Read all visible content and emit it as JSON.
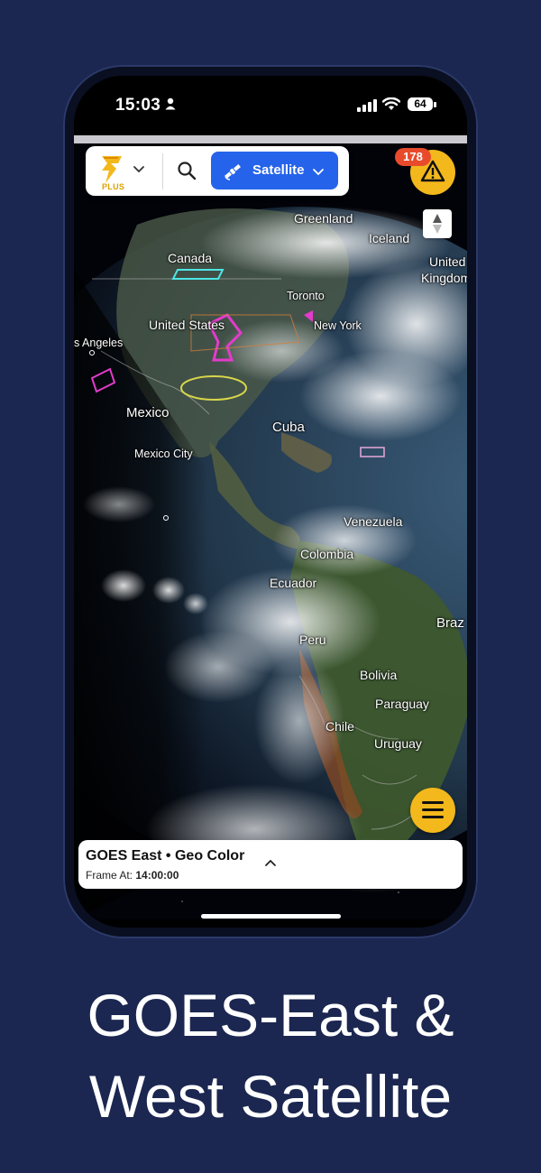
{
  "status_bar": {
    "time": "15:03",
    "battery": "64"
  },
  "toolbar": {
    "logo_badge": "PLUS",
    "layer_button_label": "Satellite"
  },
  "alerts": {
    "count": "178"
  },
  "map_labels": {
    "greenland": "Greenland",
    "iceland": "Iceland",
    "united_kingdom_1": "United",
    "united_kingdom_2": "Kingdom",
    "canada": "Canada",
    "toronto": "Toronto",
    "united_states": "United States",
    "new_york": "New York",
    "los_angeles": "s Angeles",
    "mexico": "Mexico",
    "mexico_city": "Mexico City",
    "cuba": "Cuba",
    "venezuela": "Venezuela",
    "colombia": "Colombia",
    "ecuador": "Ecuador",
    "brazil": "Braz",
    "peru": "Peru",
    "bolivia": "Bolivia",
    "paraguay": "Paraguay",
    "chile": "Chile",
    "uruguay": "Uruguay"
  },
  "info_card": {
    "title": "GOES East • Geo Color",
    "frame_label": "Frame At:",
    "frame_time": "14:00:00"
  },
  "headline": {
    "line1": "GOES-East &",
    "line2": "West Satellite"
  },
  "colors": {
    "background": "#1b2750",
    "accent_blue": "#2563eb",
    "accent_yellow": "#f3b81c",
    "badge_red": "#e84b2c"
  },
  "icons": [
    "person-icon",
    "signal-icon",
    "wifi-icon",
    "lightning-logo-icon",
    "chevron-down-icon",
    "search-icon",
    "satellite-icon",
    "warning-icon",
    "compass-icon",
    "menu-icon",
    "chevron-up-icon"
  ]
}
